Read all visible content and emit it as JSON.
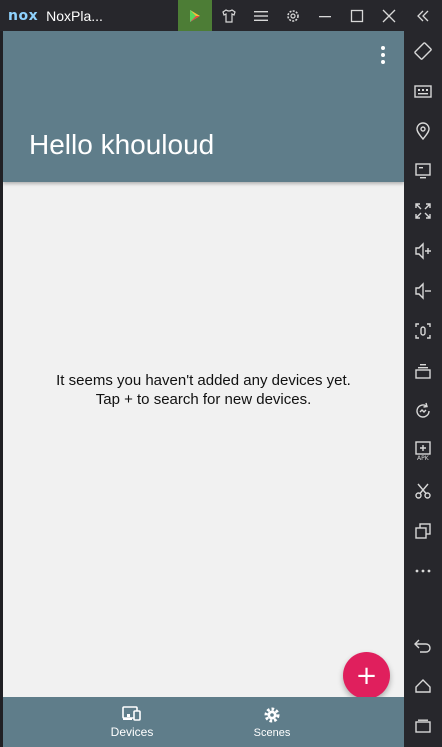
{
  "titlebar": {
    "logo": "nox",
    "app_title": "NoxPla...",
    "buttons": [
      "play-store-icon",
      "theme-icon",
      "menu-icon",
      "settings-icon",
      "minimize-icon",
      "maximize-icon",
      "close-icon",
      "collapse-sidebar-icon"
    ]
  },
  "sidebar": {
    "items": [
      "rotate-icon",
      "keyboard-icon",
      "location-icon",
      "screen-icon",
      "fullscreen-icon",
      "volume-up-icon",
      "volume-down-icon",
      "screenshot-icon",
      "multi-instance-icon",
      "shake-icon",
      "apk-install-icon",
      "scissors-icon",
      "copy-icon",
      "more-icon",
      "back-icon",
      "home-icon",
      "recents-icon"
    ]
  },
  "app": {
    "greeting": "Hello khouloud",
    "empty_line1": "It seems you haven't added any devices yet.",
    "empty_line2": "Tap + to search for new devices.",
    "fab_label": "+",
    "nav": [
      {
        "label": "Devices",
        "icon": "devices-icon"
      },
      {
        "label": "Scenes",
        "icon": "gear-icon"
      }
    ]
  },
  "colors": {
    "appbar": "#5f7d8a",
    "fab": "#e01f5d",
    "background": "#f1f1f1"
  }
}
